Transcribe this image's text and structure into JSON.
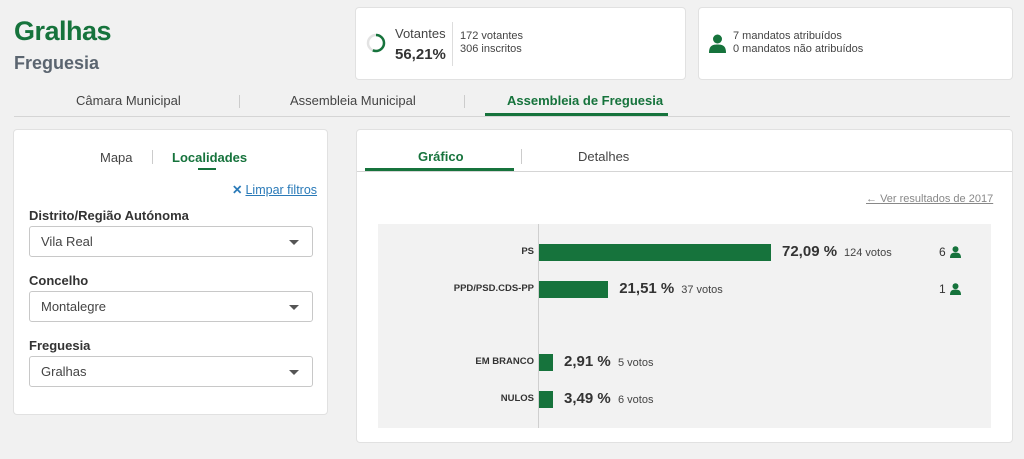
{
  "header": {
    "title": "Gralhas",
    "subtitle": "Freguesia"
  },
  "voters": {
    "label": "Votantes",
    "percent": "56,21%",
    "percent_value": 56.21,
    "votes": "172 votantes",
    "registered": "306 inscritos"
  },
  "mandates": {
    "assigned": "7 mandatos atribuídos",
    "unassigned": "0 mandatos não atribuídos"
  },
  "main_tabs": [
    "Câmara Municipal",
    "Assembleia Municipal",
    "Assembleia de Freguesia"
  ],
  "left": {
    "tabs": [
      "Mapa",
      "Localidades"
    ],
    "clear_filters": "Limpar filtros",
    "fields": [
      {
        "label": "Distrito/Região Autónoma",
        "value": "Vila Real"
      },
      {
        "label": "Concelho",
        "value": "Montalegre"
      },
      {
        "label": "Freguesia",
        "value": "Gralhas"
      }
    ]
  },
  "right": {
    "tabs": [
      "Gráfico",
      "Detalhes"
    ],
    "previous_results": "Ver resultados de 2017"
  },
  "colors": {
    "accent": "#16733c",
    "link": "#2a7ab8"
  },
  "chart_data": {
    "type": "bar",
    "orientation": "horizontal",
    "bars": [
      {
        "label": "PS",
        "value": 72.09,
        "pct_text": "72,09 %",
        "votes_text": "124 votos",
        "seats": "6"
      },
      {
        "label": "PPD/PSD.CDS-PP",
        "value": 21.51,
        "pct_text": "21,51 %",
        "votes_text": "37 votos",
        "seats": "1"
      },
      {
        "label": "EM BRANCO",
        "value": 2.91,
        "pct_text": "2,91 %",
        "votes_text": "5 votos",
        "seats": ""
      },
      {
        "label": "NULOS",
        "value": 3.49,
        "pct_text": "3,49 %",
        "votes_text": "6 votos",
        "seats": ""
      }
    ]
  }
}
